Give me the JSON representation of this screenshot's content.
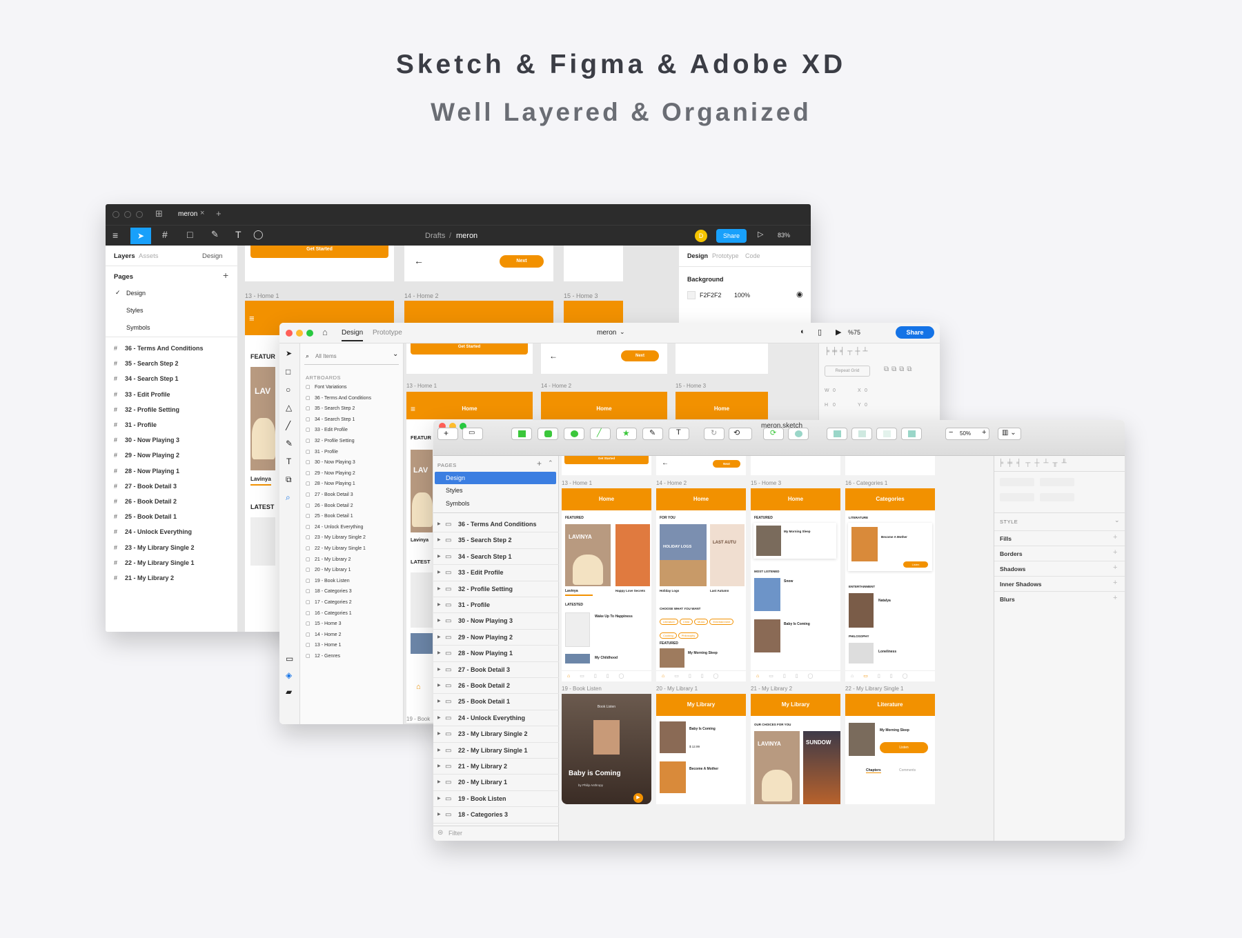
{
  "headline": "Sketch & Figma & Adobe XD",
  "subheadline": "Well Layered & Organized",
  "figma": {
    "tab": "meron",
    "breadcrumb_parent": "Drafts",
    "breadcrumb_sep": "/",
    "file": "meron",
    "avatar": "D",
    "share": "Share",
    "zoom": "83%",
    "left_tabs": [
      "Layers",
      "Assets",
      "Design"
    ],
    "pages_title": "Pages",
    "pages": [
      "Design",
      "Styles",
      "Symbols"
    ],
    "layers": [
      "36 - Terms And Conditions",
      "35 - Search Step 2",
      "34 - Search Step 1",
      "33 - Edit Profile",
      "32 - Profile Setting",
      "31 - Profile",
      "30 - Now Playing 3",
      "29 - Now Playing  2",
      "28 - Now Playing 1",
      "27 - Book Detail 3",
      "26 - Book Detail 2",
      "25 - Book Detail 1",
      "24 - Unlock Everything",
      "23 - My Library Single 2",
      "22 - My Library Single 1",
      "21 - My Library 2"
    ],
    "right_tabs": [
      "Design",
      "Prototype",
      "Code"
    ],
    "background_label": "Background",
    "bg_hex": "F2F2F2",
    "bg_opacity": "100%",
    "canvas": {
      "get_started": "Get Started",
      "next": "Next",
      "labels": [
        "13 - Home 1",
        "14 - Home 2",
        "15 - Home 3"
      ],
      "featured": "FEATUR",
      "latest": "LATEST",
      "book_author": "Lavinya",
      "cover_text": "LAV"
    }
  },
  "xd": {
    "tabs": [
      "Design",
      "Prototype"
    ],
    "file": "meron",
    "zoom": "%75",
    "share": "Share",
    "search_placeholder": "All Items",
    "artboards_title": "ARTBOARDS",
    "artboards": [
      "Font Variations",
      "36 - Terms And Conditions",
      "35 - Search Step 2",
      "34 - Search Step 1",
      "33 - Edit Profile",
      "32 - Profile Setting",
      "31 - Profile",
      "30 - Now Playing 3",
      "29 - Now Playing  2",
      "28 - Now Playing 1",
      "27 - Book Detail 3",
      "26 - Book Detail 2",
      "25 - Book Detail 1",
      "24 - Unlock Everything",
      "23 - My Library Single 2",
      "22 - My Library Single 1",
      "21 - My Library 2",
      "20 - My Library 1",
      "19 - Book Listen",
      "18 - Categories 3",
      "17 - Categories 2",
      "16 - Categories 1",
      "15 - Home 3",
      "14 - Home 2",
      "13 - Home 1",
      "12 - Genres"
    ],
    "repeat_grid": "Repeat Grid",
    "props": [
      "W",
      "0",
      "X",
      "0",
      "H",
      "0",
      "Y",
      "0"
    ],
    "canvas": {
      "get_started": "Get Started",
      "next": "Next",
      "labels": [
        "13 - Home 1",
        "14 - Home 2",
        "15 - Home 3"
      ],
      "home": "Home",
      "featured": "FEATUR",
      "latest": "LATEST",
      "book_author": "Lavinya",
      "cover_text": "LAV",
      "bottom_label": "19 - Book"
    }
  },
  "sketch": {
    "file": "meron.sketch",
    "zoom": "50%",
    "pages_title": "PAGES",
    "pages": [
      "Design",
      "Styles",
      "Symbols"
    ],
    "layers": [
      "36 - Terms And Conditions",
      "35 - Search Step 2",
      "34 - Search Step 1",
      "33 - Edit Profile",
      "32 - Profile Setting",
      "31 - Profile",
      "30 - Now Playing 3",
      "29 - Now Playing  2",
      "28 - Now Playing 1",
      "27 - Book Detail 3",
      "26 - Book Detail 2",
      "25 - Book Detail 1",
      "24 - Unlock Everything",
      "23 - My Library Single 2",
      "22 - My Library Single 1",
      "21 - My Library 2",
      "20 - My Library 1",
      "19 - Book Listen",
      "18 - Categories 3"
    ],
    "filter": "Filter",
    "style_title": "STYLE",
    "style_items": [
      "Fills",
      "Borders",
      "Shadows",
      "Inner Shadows",
      "Blurs"
    ],
    "artboard_labels": [
      "13 - Home 1",
      "14 - Home 2",
      "15 - Home 3",
      "16 - Categories 1",
      "19 - Book Listen",
      "20 - My Library 1",
      "21 - My Library 2",
      "22 - My Library Single 1"
    ],
    "artboard_titles": [
      "Home",
      "Home",
      "Home",
      "Categories",
      "Book Listen",
      "My Library",
      "My Library",
      "Literature"
    ],
    "canvas": {
      "get_started": "Get Started",
      "next": "Next",
      "featured": "FEATURED",
      "for_you": "FOR YOU",
      "latested": "LATESTED",
      "most_listened": "MOST LISTENED",
      "choose": "CHOOSE WHAT YOU WANT",
      "literature": "LITERATURE",
      "entertainment": "ENTERTAINMENT",
      "philosophy": "PHILOSOPHY",
      "choices": "OUR CHOICES FOR YOU",
      "book1": "Lavinya",
      "book2": "Happy Love Secrets",
      "book3": "Holiday Logs",
      "book4": "Last Autumn",
      "list1": "Wake Up To Happiness",
      "list2": "My Childhood",
      "list3": "My Morning Sleep",
      "snow": "Snow",
      "baby": "Baby Is Coming",
      "mother": "Become A Mother",
      "natalya": "Natalya",
      "loneliness": "Loneliness",
      "listen_title": "Baby is Coming",
      "listen_sub": "by Philip Anthropy",
      "listen": "Listen",
      "chapters": "Chapters",
      "comments": "Comments",
      "tags": [
        "Literature",
        "Child",
        "Music",
        "Entertainment",
        "Cooking",
        "Philosophy"
      ],
      "cover_lavinya": "LAVINYA",
      "cover_holiday": "HOLIDAY LOGS",
      "cover_autumn": "LAST AUTU",
      "cover_sundown": "SUNDOW",
      "price": "$ 12.99"
    }
  },
  "colors": {
    "accent": "#f29100",
    "figma_blue": "#18a0fb",
    "xd_blue": "#1473e6",
    "sketch_select": "#3b7ee1"
  }
}
